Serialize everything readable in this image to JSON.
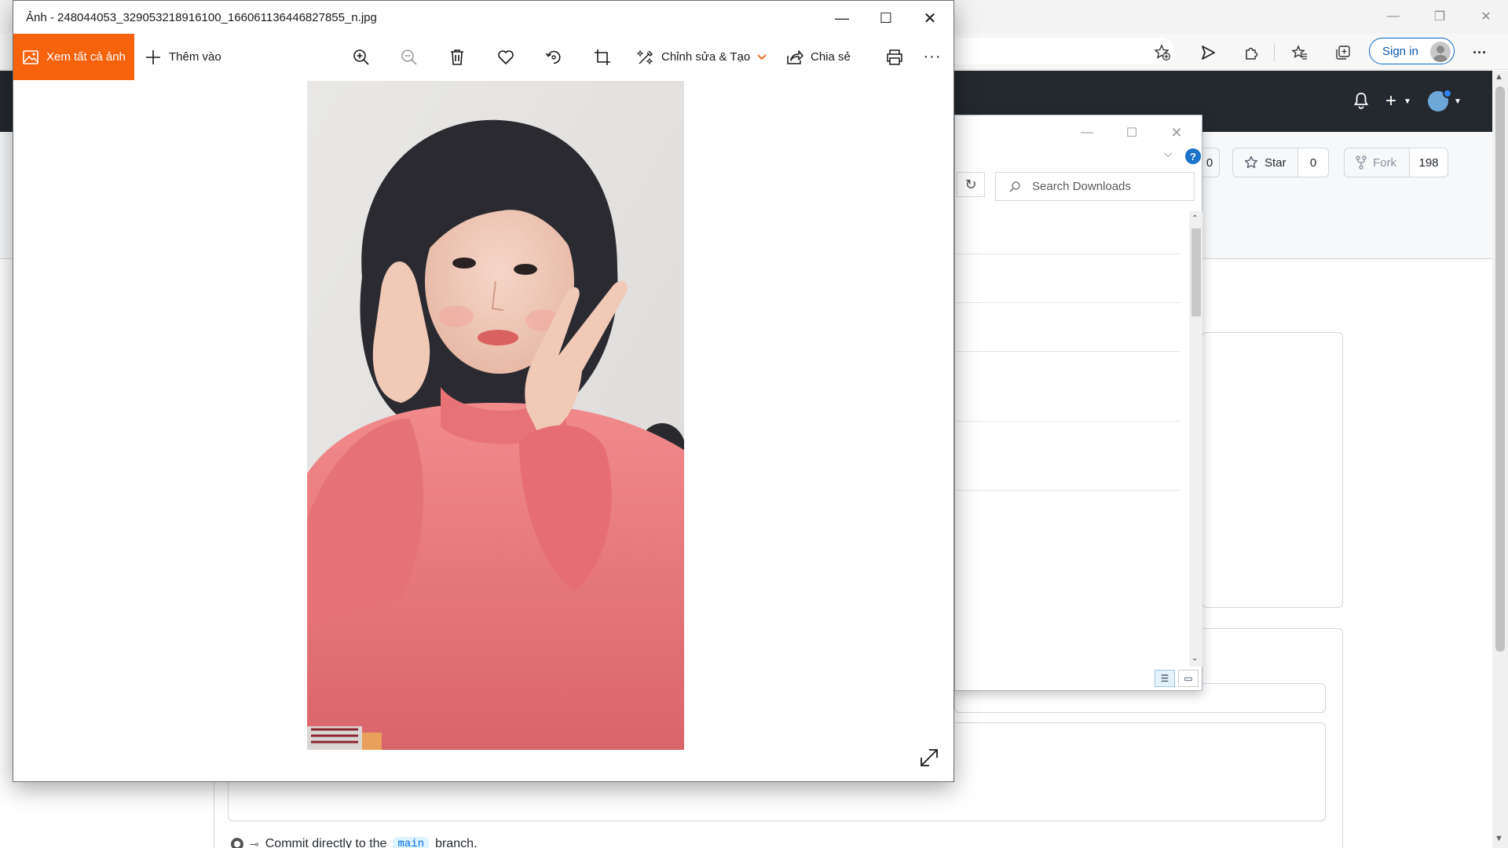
{
  "browser": {
    "sign_in_label": "Sign in",
    "more_label": "···"
  },
  "github": {
    "star_label": "Star",
    "star_count": "0",
    "fork_label": "Fork",
    "fork_count": "198",
    "partial_count": "0",
    "commit_text": "Commit directly to the",
    "branch_name": "main",
    "branch_suffix": "branch."
  },
  "downloads": {
    "search_placeholder": "Search Downloads",
    "help_label": "?"
  },
  "photos": {
    "window_title": "Ảnh - 248044053_329053218916100_1660611364468278​55_n.jpg",
    "view_all_label": "Xem tất cả ảnh",
    "add_to_label": "Thêm vào",
    "edit_create_label": "Chỉnh sửa & Tạo",
    "share_label": "Chia sẻ",
    "more_label": "···"
  },
  "colors": {
    "photos_accent": "#f7630c",
    "github_header": "#24292f",
    "edge_signin_blue": "#0a66c2",
    "help_blue": "#1a73c8"
  },
  "icons": [
    "zoom-in-icon",
    "zoom-out-icon",
    "delete-icon",
    "favorite-icon",
    "rotate-icon",
    "crop-icon",
    "edit-create-icon",
    "share-icon",
    "print-icon",
    "expand-icon",
    "bell-icon",
    "plus-icon",
    "star-icon",
    "fork-icon",
    "search-icon",
    "refresh-icon"
  ]
}
